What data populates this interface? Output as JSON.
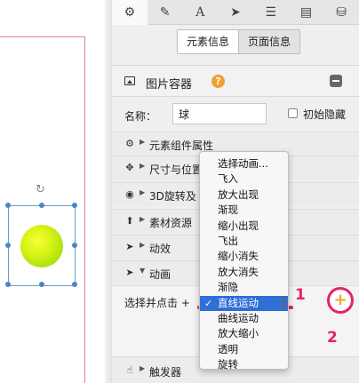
{
  "toolbar": {
    "buttons": [
      {
        "name": "gear-icon",
        "glyph": "⚙"
      },
      {
        "name": "pencil-icon",
        "glyph": "✎"
      },
      {
        "name": "text-icon",
        "glyph": "A"
      },
      {
        "name": "send-icon",
        "glyph": "➤"
      },
      {
        "name": "list-icon",
        "glyph": "☰"
      },
      {
        "name": "document-icon",
        "glyph": "▤"
      },
      {
        "name": "database-icon",
        "glyph": "⛁"
      }
    ]
  },
  "info_tabs": [
    "元素信息",
    "页面信息"
  ],
  "container": {
    "title": "图片容器",
    "help_glyph": "?"
  },
  "name_field": {
    "label": "名称：",
    "value": "球"
  },
  "initial_hide_label": "初始隐藏",
  "sections": [
    {
      "icon": "⚙",
      "label": "元素组件属性"
    },
    {
      "icon": "✥",
      "label": "尺寸与位置"
    },
    {
      "icon": "◉",
      "label": "3D旋转及"
    },
    {
      "icon": "⬆",
      "label": "素材资源"
    },
    {
      "icon": "➤",
      "label": "动效"
    },
    {
      "icon": "➤",
      "label": "动画"
    }
  ],
  "animation": {
    "select_label": "选择并点击 +",
    "annotation_1": "1",
    "annotation_2": "2"
  },
  "trigger_section": {
    "icon": "☝",
    "label": "触发器"
  },
  "dropdown": {
    "options": [
      "选择动画...",
      "飞入",
      "放大出现",
      "渐现",
      "缩小出现",
      "飞出",
      "缩小消失",
      "放大消失",
      "渐隐",
      "直线运动",
      "曲线运动",
      "放大缩小",
      "透明",
      "旋转"
    ],
    "selected": "直线运动",
    "check_glyph": "✓"
  },
  "canvas": {
    "rotate_glyph": "↻"
  },
  "colors": {
    "accent_pink": "#e8216b",
    "selection_blue": "#2f6fd6",
    "help_orange": "#f0a12e",
    "ball_green": "#c7ec12"
  }
}
